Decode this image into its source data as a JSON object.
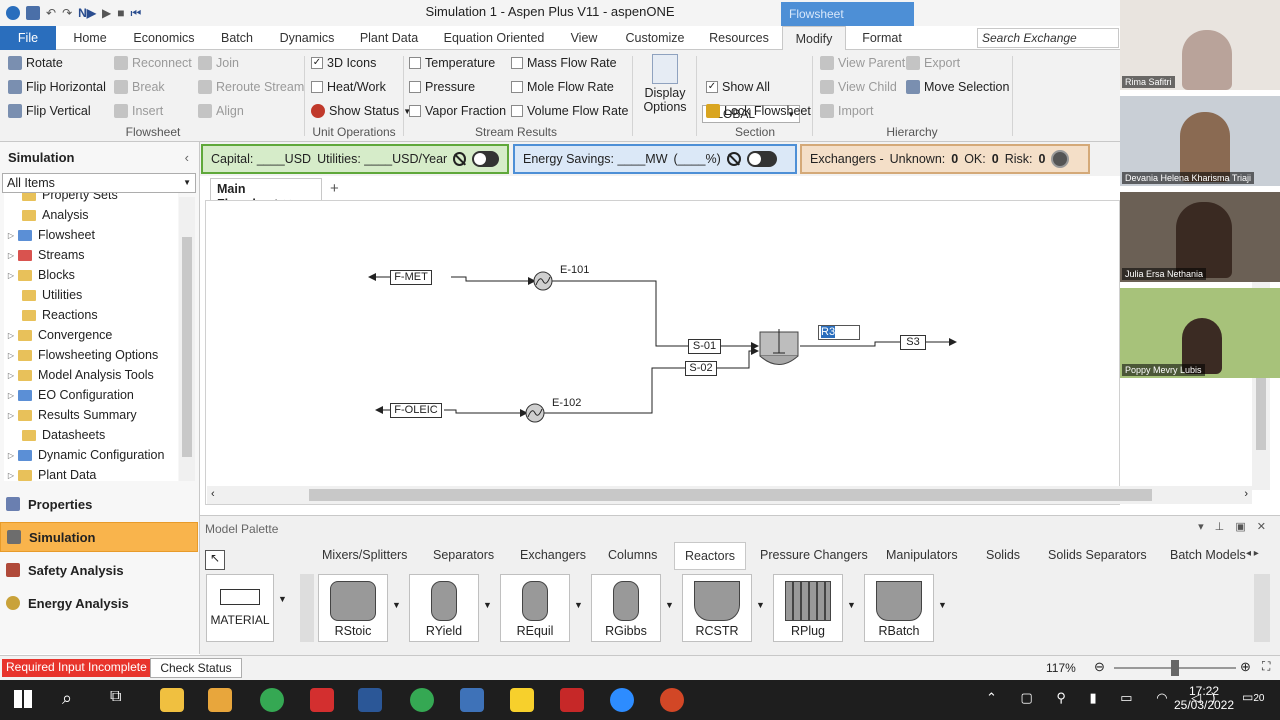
{
  "window": {
    "title": "Simulation 1 - Aspen Plus V11 - aspenONE",
    "context_tab": "Flowsheet"
  },
  "tabs": [
    {
      "label": "File"
    },
    {
      "label": "Home"
    },
    {
      "label": "Economics"
    },
    {
      "label": "Batch"
    },
    {
      "label": "Dynamics"
    },
    {
      "label": "Plant Data"
    },
    {
      "label": "Equation Oriented"
    },
    {
      "label": "View"
    },
    {
      "label": "Customize"
    },
    {
      "label": "Resources"
    },
    {
      "label": "Modify"
    },
    {
      "label": "Format"
    }
  ],
  "search": {
    "placeholder": "Search Exchange"
  },
  "ribbon": {
    "flowsheet": {
      "rotate": "Rotate",
      "flip_h": "Flip Horizontal",
      "flip_v": "Flip Vertical",
      "reconnect": "Reconnect",
      "break": "Break",
      "insert": "Insert",
      "join": "Join",
      "reroute": "Reroute Stream",
      "align": "Align",
      "group": "Flowsheet"
    },
    "unit_ops": {
      "icons3d": "3D Icons",
      "heatwork": "Heat/Work",
      "show_status": "Show Status",
      "group": "Unit Operations"
    },
    "stream_results": {
      "temperature": "Temperature",
      "pressure": "Pressure",
      "vapor_fraction": "Vapor Fraction",
      "mass_flow": "Mass Flow Rate",
      "mole_flow": "Mole Flow Rate",
      "volume_flow": "Volume Flow Rate",
      "group": "Stream Results"
    },
    "display_options": "Display Options",
    "section": {
      "value": "GLOBAL",
      "show_all": "Show All",
      "lock": "Lock Flowsheet",
      "group": "Section"
    },
    "hierarchy": {
      "view_parent": "View Parent",
      "view_child": "View Child",
      "import": "Import",
      "export": "Export",
      "move_selection": "Move Selection",
      "group": "Hierarchy"
    }
  },
  "energy_bar": {
    "capital": "Capital: ____USD",
    "utilities": "Utilities: ____USD/Year",
    "energy_savings": "Energy Savings: ____MW",
    "pct": "(____%)",
    "exchangers": "Exchangers -",
    "unknown_label": "Unknown:",
    "unknown": "0",
    "ok_label": "OK:",
    "ok": "0",
    "risk_label": "Risk:",
    "risk": "0"
  },
  "nav": {
    "header": "Simulation",
    "filter": "All Items",
    "tree": [
      {
        "label": "Property Sets"
      },
      {
        "label": "Analysis"
      },
      {
        "label": "Flowsheet"
      },
      {
        "label": "Streams"
      },
      {
        "label": "Blocks"
      },
      {
        "label": "Utilities"
      },
      {
        "label": "Reactions"
      },
      {
        "label": "Convergence"
      },
      {
        "label": "Flowsheeting Options"
      },
      {
        "label": "Model Analysis Tools"
      },
      {
        "label": "EO Configuration"
      },
      {
        "label": "Results Summary"
      },
      {
        "label": "Datasheets"
      },
      {
        "label": "Dynamic Configuration"
      },
      {
        "label": "Plant Data"
      }
    ],
    "buttons": [
      {
        "label": "Properties"
      },
      {
        "label": "Simulation"
      },
      {
        "label": "Safety Analysis"
      },
      {
        "label": "Energy Analysis"
      }
    ]
  },
  "doc_tab": "Main Flowsheet",
  "flowsheet": {
    "f_met": "F-MET",
    "e101": "E-101",
    "f_oleic": "F-OLEIC",
    "e102": "E-102",
    "s01": "S-01",
    "s02": "S-02",
    "s3": "S3",
    "editing": "R3"
  },
  "palette": {
    "title": "Model Palette",
    "tabs": [
      {
        "label": "Mixers/Splitters"
      },
      {
        "label": "Separators"
      },
      {
        "label": "Exchangers"
      },
      {
        "label": "Columns"
      },
      {
        "label": "Reactors"
      },
      {
        "label": "Pressure Changers"
      },
      {
        "label": "Manipulators"
      },
      {
        "label": "Solids"
      },
      {
        "label": "Solids Separators"
      },
      {
        "label": "Batch Models"
      }
    ],
    "material": "MATERIAL",
    "items": [
      {
        "label": "RStoic"
      },
      {
        "label": "RYield"
      },
      {
        "label": "REquil"
      },
      {
        "label": "RGibbs"
      },
      {
        "label": "RCSTR"
      },
      {
        "label": "RPlug"
      },
      {
        "label": "RBatch"
      }
    ]
  },
  "status": {
    "required": "Required Input Incomplete",
    "check": "Check Status",
    "zoom": "117%"
  },
  "taskbar": {
    "time": "17:22",
    "date": "25/03/2022",
    "notif": "20"
  },
  "participants": [
    {
      "name": "Rima Safitri"
    },
    {
      "name": "Devania Helena Kharisma Triaji"
    },
    {
      "name": "Julia Ersa Nethania"
    },
    {
      "name": "Poppy Mevry Lubis"
    }
  ]
}
